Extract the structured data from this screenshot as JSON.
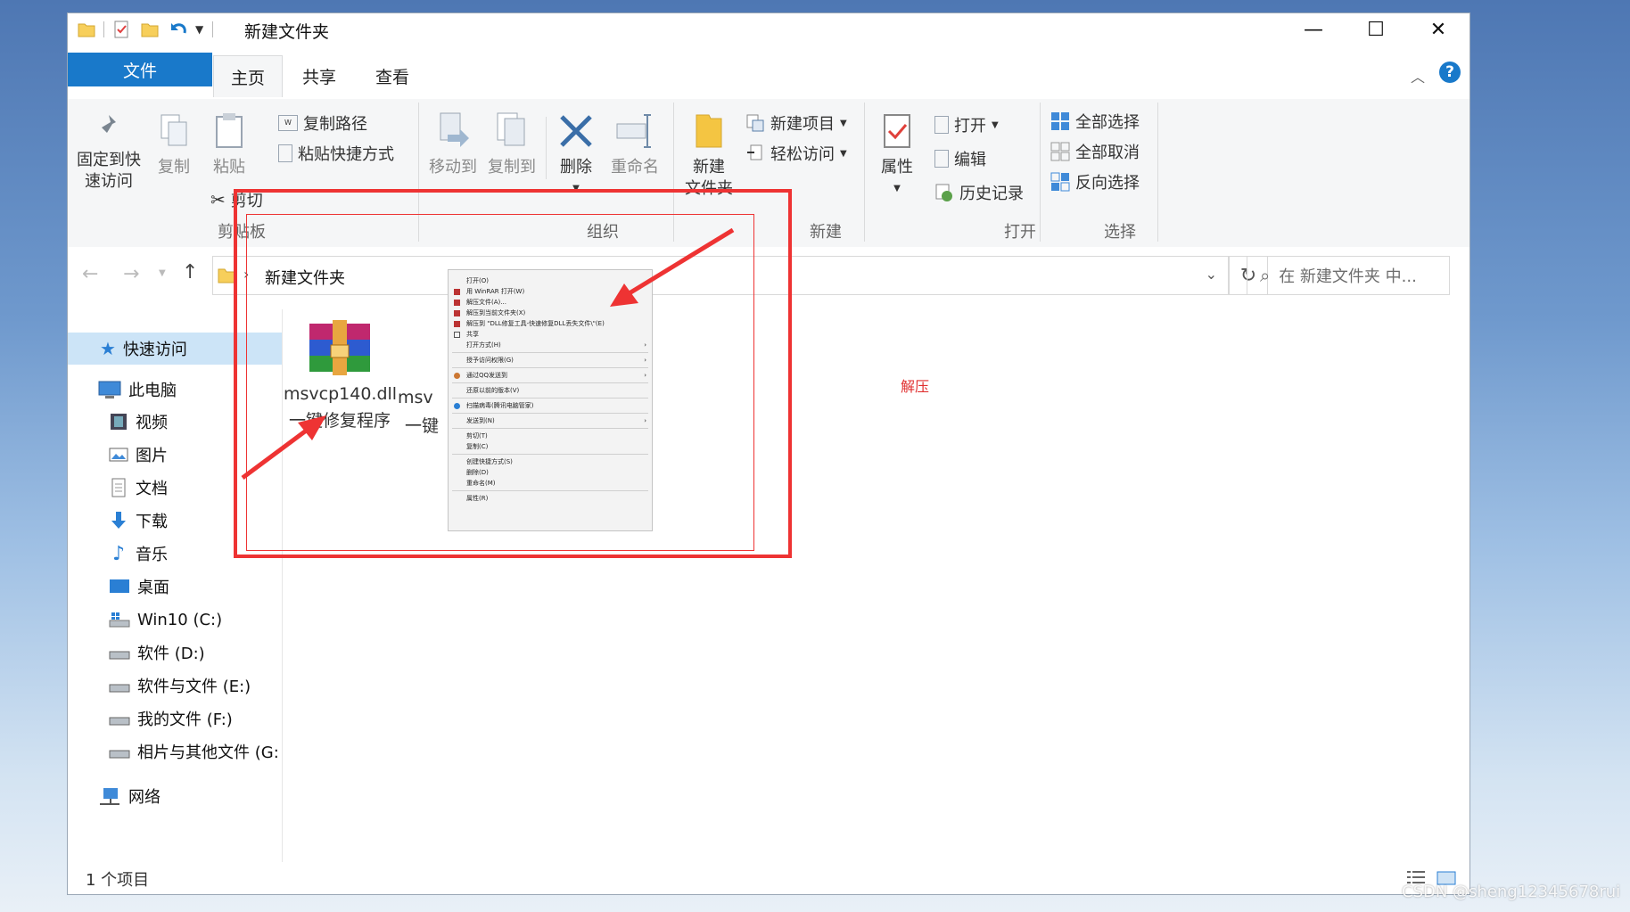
{
  "window": {
    "title": "新建文件夹",
    "controls": {
      "minimize": "—",
      "maximize": "☐",
      "close": "✕"
    }
  },
  "tabs": {
    "file": "文件",
    "home": "主页",
    "share": "共享",
    "view": "查看"
  },
  "ribbon": {
    "clipboard": {
      "pin_label_1": "固定到快",
      "pin_label_2": "速访问",
      "copy": "复制",
      "paste": "粘贴",
      "copy_path": "复制路径",
      "paste_shortcut": "粘贴快捷方式",
      "cut": "剪切",
      "group": "剪贴板"
    },
    "organize": {
      "move_to": "移动到",
      "copy_to": "复制到",
      "delete": "删除",
      "rename": "重命名",
      "group": "组织"
    },
    "new": {
      "new_folder_1": "新建",
      "new_folder_2": "文件夹",
      "new_item": "新建项目",
      "easy_access": "轻松访问",
      "group": "新建"
    },
    "open": {
      "properties": "属性",
      "open": "打开",
      "edit": "编辑",
      "history": "历史记录",
      "group": "打开"
    },
    "select": {
      "select_all": "全部选择",
      "select_none": "全部取消",
      "invert": "反向选择",
      "group": "选择"
    }
  },
  "address": {
    "path": "新建文件夹",
    "search_placeholder": "在 新建文件夹 中..."
  },
  "nav": {
    "quick_access": "快速访问",
    "this_pc": "此电脑",
    "items": [
      "视频",
      "图片",
      "文档",
      "下载",
      "音乐",
      "桌面",
      "Win10 (C:)",
      "软件 (D:)",
      "软件与文件 (E:)",
      "我的文件 (F:)",
      "相片与其他文件 (G:"
    ],
    "network": "网络"
  },
  "files": [
    {
      "name_line1": "msvcp140.dll",
      "name_line2": "一键修复程序"
    },
    {
      "name_line1": "msv",
      "name_line2": "一键"
    }
  ],
  "context_menu": {
    "items": [
      "打开(O)",
      "用 WinRAR 打开(W)",
      "解压文件(A)...",
      "解压到当前文件夹(X)",
      "解压到 \"DLL修复工具-快速修复DLL丢失文件\\\"(E)",
      "共享",
      "打开方式(H)",
      "授予访问权限(G)",
      "通过QQ发送到",
      "还原以前的版本(V)",
      "扫描病毒(腾讯电脑管家)",
      "发送到(N)",
      "剪切(T)",
      "复制(C)",
      "创建快捷方式(S)",
      "删除(D)",
      "重命名(M)",
      "属性(R)"
    ]
  },
  "annotation": "解压",
  "status": {
    "count": "1 个项目"
  },
  "watermark": "CSDN @sheng12345678rui",
  "colors": {
    "accent": "#1979ca",
    "annotation_red": "#ee3333"
  }
}
